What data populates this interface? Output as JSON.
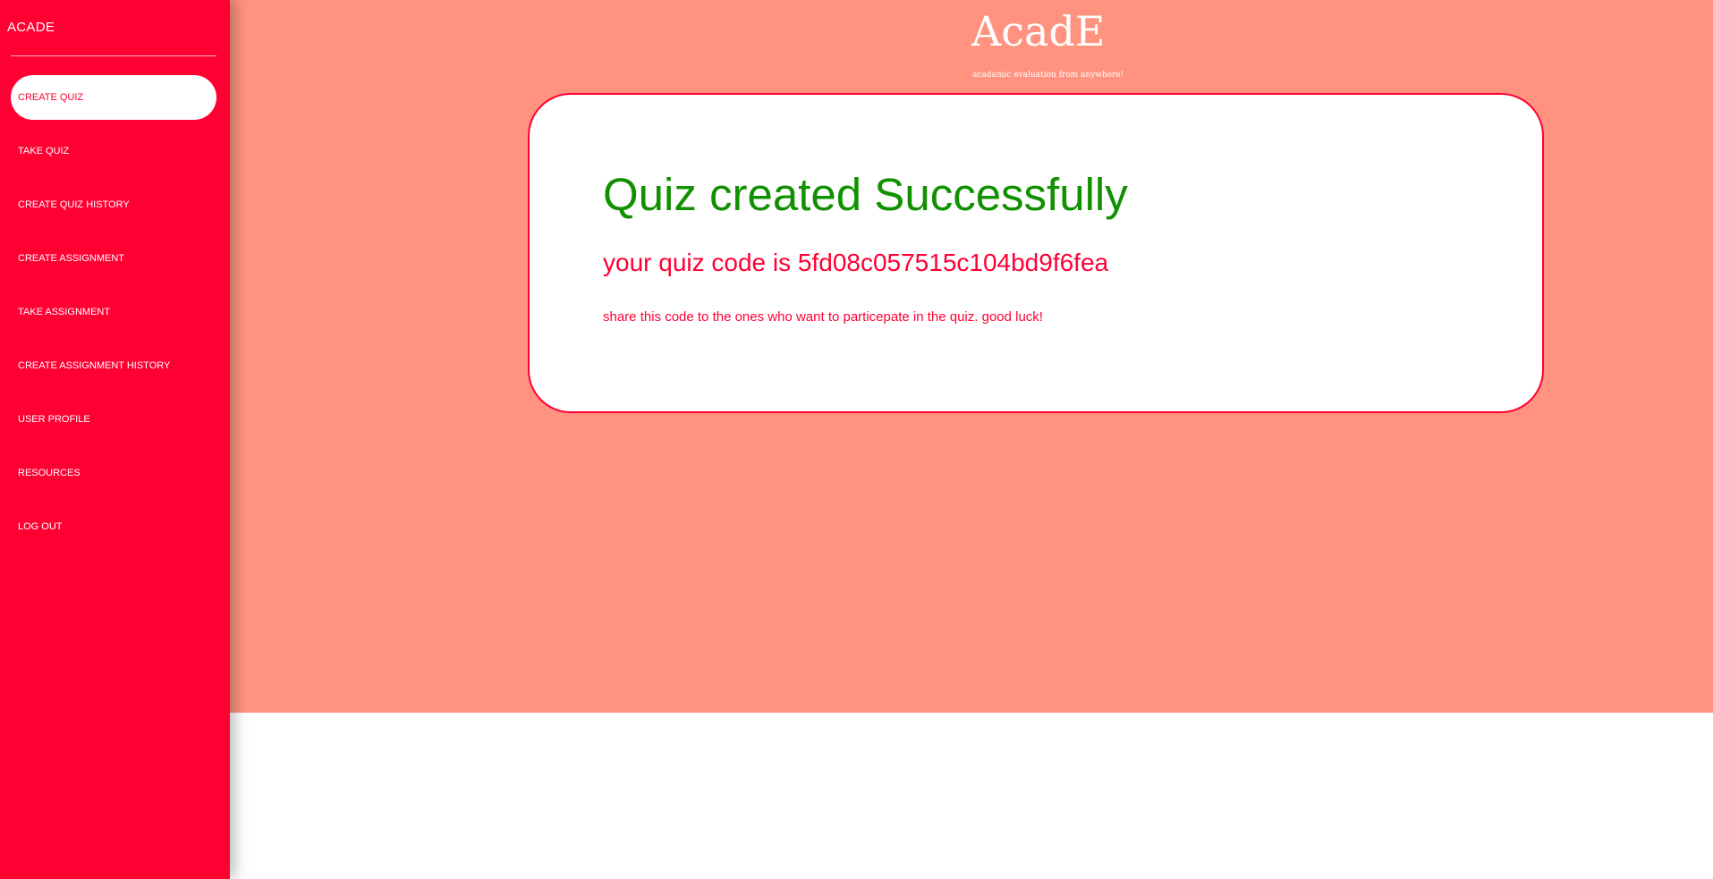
{
  "sidebar": {
    "brand": "ACADE",
    "items": [
      {
        "label": "CREATE QUIZ"
      },
      {
        "label": "TAKE QUIZ"
      },
      {
        "label": "CREATE QUIZ HISTORY"
      },
      {
        "label": "CREATE ASSIGNMENT"
      },
      {
        "label": "TAKE ASSIGNMENT"
      },
      {
        "label": "CREATE ASSIGNMENT HISTORY"
      },
      {
        "label": "USER PROFILE"
      },
      {
        "label": "RESOURCES"
      },
      {
        "label": "LOG OUT"
      }
    ],
    "active": "CREATE QUIZ"
  },
  "header": {
    "logo": "AcadE",
    "tagline": "acadamic evaluation from anywhere!"
  },
  "card": {
    "title": "Quiz created Successfully",
    "code_text": "your quiz code is 5fd08c057515c104bd9f6fea",
    "note": "share this code to the ones who want to particepate in the quiz. good luck!"
  },
  "colors": {
    "sidebar": "#ff0033",
    "main_background": "#ff9380",
    "success": "#119100",
    "accent": "#ff0033"
  }
}
